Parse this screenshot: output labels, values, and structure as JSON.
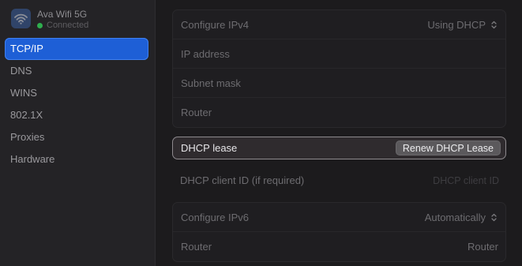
{
  "sidebar": {
    "network": {
      "name": "Ava Wifi 5G",
      "status": "Connected",
      "status_color": "#2fae4e",
      "icon": "wifi-icon"
    },
    "items": [
      {
        "label": "TCP/IP",
        "active": true
      },
      {
        "label": "DNS"
      },
      {
        "label": "WINS"
      },
      {
        "label": "802.1X"
      },
      {
        "label": "Proxies"
      },
      {
        "label": "Hardware"
      }
    ]
  },
  "ipv4": {
    "configure_label": "Configure IPv4",
    "configure_value": "Using DHCP",
    "ip_label": "IP address",
    "subnet_label": "Subnet mask",
    "router_label": "Router"
  },
  "dhcp": {
    "lease_label": "DHCP lease",
    "renew_label": "Renew DHCP Lease",
    "client_id_label": "DHCP client ID (if required)",
    "client_id_placeholder": "DHCP client ID"
  },
  "ipv6": {
    "configure_label": "Configure IPv6",
    "configure_value": "Automatically",
    "router_label": "Router",
    "router_value": "Router"
  },
  "colors": {
    "accent": "#1e5fd6"
  }
}
